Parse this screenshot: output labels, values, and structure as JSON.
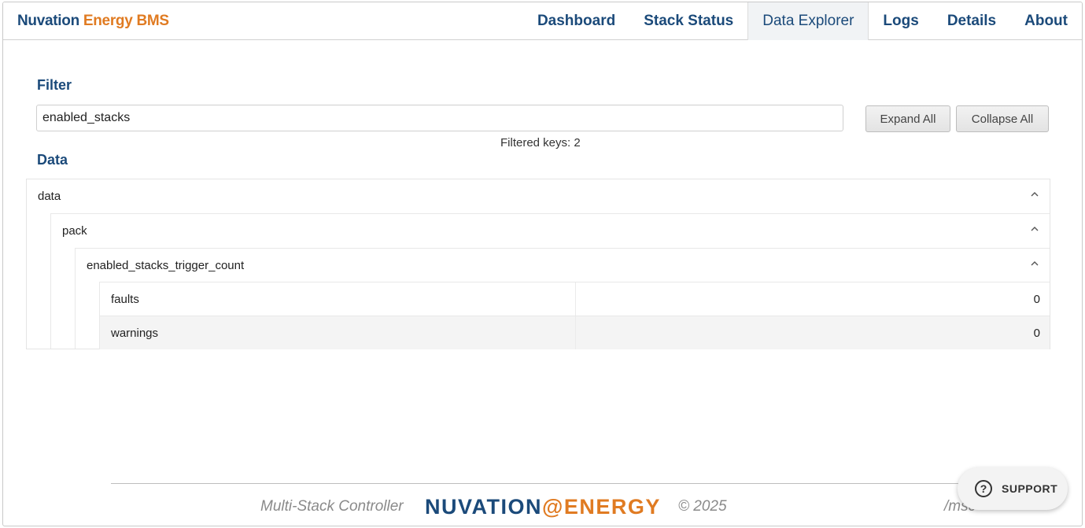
{
  "brand": {
    "part1": "Nuvation",
    "part2": "Energy BMS"
  },
  "nav": {
    "items": [
      {
        "label": "Dashboard"
      },
      {
        "label": "Stack Status"
      },
      {
        "label": "Data Explorer",
        "active": true
      },
      {
        "label": "Logs"
      },
      {
        "label": "Details"
      },
      {
        "label": "About"
      }
    ]
  },
  "filter": {
    "title": "Filter",
    "value": "enabled_stacks",
    "expand_label": "Expand All",
    "collapse_label": "Collapse All",
    "filtered_keys": "Filtered keys: 2"
  },
  "data_section": {
    "title": "Data",
    "tree": {
      "root": "data",
      "child": "pack",
      "grandchild": "enabled_stacks_trigger_count",
      "leaves": [
        {
          "key": "faults",
          "value": "0"
        },
        {
          "key": "warnings",
          "value": "0"
        }
      ]
    }
  },
  "footer": {
    "product": "Multi-Stack Controller",
    "logo_part1": "NUVATION",
    "logo_part2": "ENERGY",
    "copyright": "© 2025",
    "path": "/msc"
  },
  "support": {
    "icon": "question-circle-icon",
    "label": "SUPPORT"
  },
  "colors": {
    "brand_blue": "#1b4a7a",
    "brand_orange": "#e07b22"
  }
}
